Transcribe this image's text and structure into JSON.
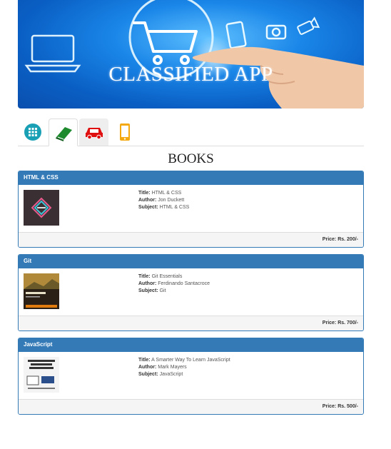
{
  "banner": {
    "title": "CLASSIFIED APP"
  },
  "tabs": [
    {
      "name": "all",
      "icon": "grid-icon",
      "color": "#1aa0b5"
    },
    {
      "name": "books",
      "icon": "book-icon",
      "color": "#1e8a2e"
    },
    {
      "name": "cars",
      "icon": "car-icon",
      "color": "#e01010"
    },
    {
      "name": "mobiles",
      "icon": "mobile-icon",
      "color": "#f4a911"
    }
  ],
  "section_title": "BOOKS",
  "labels": {
    "title": "Title:",
    "author": "Author:",
    "subject": "Subject:"
  },
  "books": [
    {
      "heading": "HTML & CSS",
      "title": "HTML & CSS",
      "author": "Jon Duckett",
      "subject": "HTML & CSS",
      "price": "Price: Rs. 200/-"
    },
    {
      "heading": "Git",
      "title": "Git Essentials",
      "author": "Ferdinando Santacroce",
      "subject": "Git",
      "price": "Price: Rs. 700/-"
    },
    {
      "heading": "JavaScript",
      "title": "A Smarter Way To Learn JavaScript",
      "author": "Mark Mayers",
      "subject": "JavaScript",
      "price": "Price: Rs. 500/-"
    }
  ],
  "colors": {
    "primary": "#337ab7",
    "footer_bg": "#f5f5f5"
  }
}
